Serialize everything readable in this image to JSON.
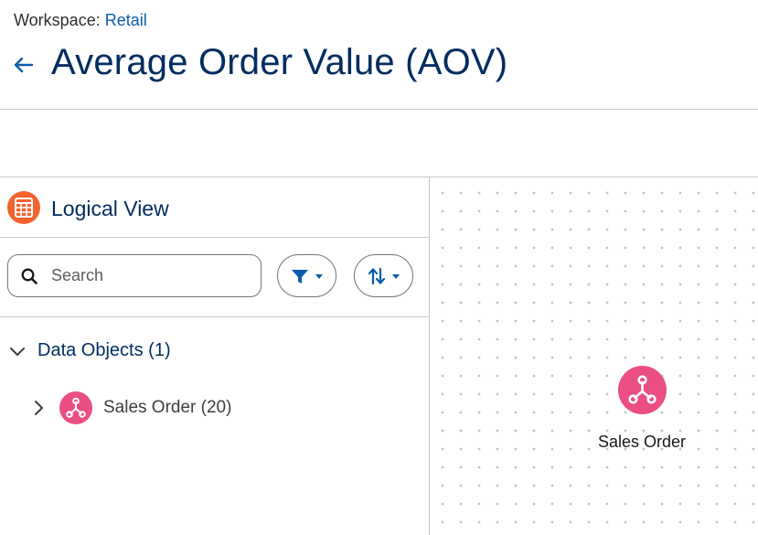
{
  "header": {
    "workspace_prefix": "Workspace:",
    "workspace_name": "Retail",
    "title": "Average Order Value (AOV)",
    "back_icon": "arrow-left-icon"
  },
  "logical_view": {
    "title": "Logical View",
    "icon": "table-icon",
    "search": {
      "placeholder": "Search",
      "value": ""
    },
    "filter_icon": "filter-icon",
    "sort_icon": "sort-icon",
    "group": {
      "label": "Data Objects (1)",
      "expanded": true
    },
    "items": [
      {
        "label": "Sales Order (20)",
        "icon": "data-object-icon",
        "expanded": false
      }
    ]
  },
  "canvas": {
    "nodes": [
      {
        "label": "Sales Order",
        "icon": "data-object-icon"
      }
    ]
  },
  "colors": {
    "title": "#032d60",
    "link": "#0b5cab",
    "logical_view_icon": "#f2632f",
    "data_object_icon": "#ea4e84",
    "action_icon": "#0b5cab"
  }
}
